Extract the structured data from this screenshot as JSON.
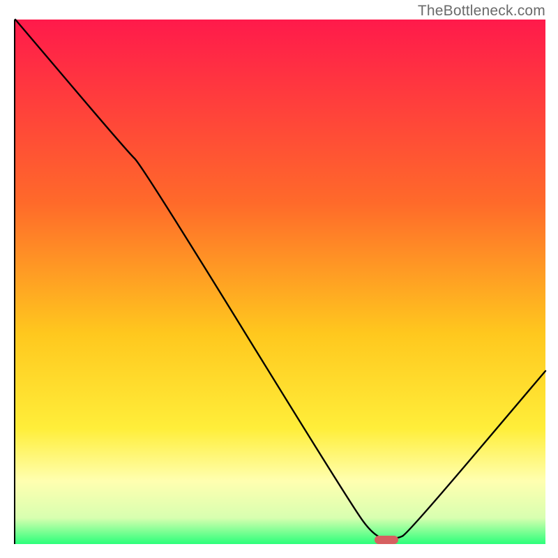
{
  "attribution": "TheBottleneck.com",
  "chart_data": {
    "type": "line",
    "title": "",
    "xlabel": "",
    "ylabel": "",
    "xlim": [
      0,
      100
    ],
    "ylim": [
      0,
      100
    ],
    "gradient_stops": [
      {
        "offset": 0,
        "color": "#ff1a4b"
      },
      {
        "offset": 0.35,
        "color": "#ff6a2a"
      },
      {
        "offset": 0.6,
        "color": "#ffc81e"
      },
      {
        "offset": 0.78,
        "color": "#ffee3a"
      },
      {
        "offset": 0.88,
        "color": "#ffffb0"
      },
      {
        "offset": 0.95,
        "color": "#d8ffb0"
      },
      {
        "offset": 1.0,
        "color": "#2bff7a"
      }
    ],
    "series": [
      {
        "name": "bottleneck-curve",
        "x": [
          0,
          21,
          24,
          63,
          68,
          72,
          74,
          100
        ],
        "y": [
          100,
          75,
          72,
          8,
          1,
          1,
          2,
          33
        ]
      }
    ],
    "marker": {
      "x": 70,
      "y": 0.8,
      "w": 4.5,
      "h": 1.6
    },
    "annotations": []
  }
}
